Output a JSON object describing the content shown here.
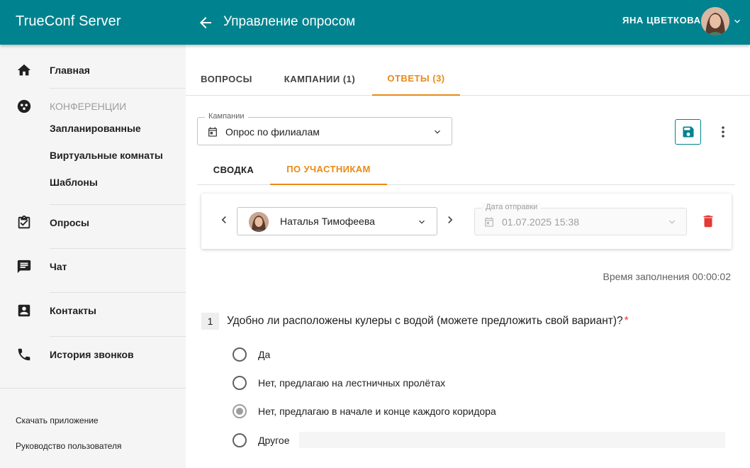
{
  "header": {
    "brand": "TrueConf Server",
    "title": "Управление опросом",
    "user_name": "ЯНА ЦВЕТКОВА",
    "bg_color": "#00838f"
  },
  "sidebar": {
    "items": [
      {
        "label": "Главная",
        "icon": "home-icon"
      },
      {
        "label": "КОНФЕРЕНЦИИ",
        "icon": "conference-icon"
      },
      {
        "label": "Опросы",
        "icon": "poll-icon"
      },
      {
        "label": "Чат",
        "icon": "chat-icon"
      },
      {
        "label": "Контакты",
        "icon": "contacts-icon"
      },
      {
        "label": "История звонков",
        "icon": "phone-icon"
      }
    ],
    "conference_subitems": [
      "Запланированные",
      "Виртуальные комнаты",
      "Шаблоны"
    ],
    "footer_links": [
      "Скачать приложение",
      "Руководство пользователя"
    ]
  },
  "tabs": [
    "ВОПРОСЫ",
    "КАМПАНИИ (1)",
    "ОТВЕТЫ (3)"
  ],
  "active_tab": "ОТВЕТЫ (3)",
  "campaign": {
    "legend": "Кампании",
    "value": "Опрос по филиалам"
  },
  "subtabs": [
    "СВОДКА",
    "ПО УЧАСТНИКАМ"
  ],
  "active_subtab": "ПО УЧАСТНИКАМ",
  "response": {
    "participant": "Наталья Тимофеева",
    "date_legend": "Дата отправки",
    "date_value": "01.07.2025 15:38",
    "fill_time": "Время заполнения 00:00:02"
  },
  "question": {
    "number": "1",
    "text": "Удобно ли расположены кулеры с водой (можете предложить свой вариант)?",
    "required_mark": "*",
    "options": [
      {
        "label": "Да",
        "checked": false
      },
      {
        "label": "Нет, предлагаю на лестничных пролётах",
        "checked": false
      },
      {
        "label": "Нет, предлагаю в начале и конце каждого коридора",
        "checked": true
      },
      {
        "label": "Другое",
        "checked": false
      }
    ]
  },
  "colors": {
    "accent": "#e98a15",
    "teal": "#00838f",
    "danger": "#e53935"
  }
}
